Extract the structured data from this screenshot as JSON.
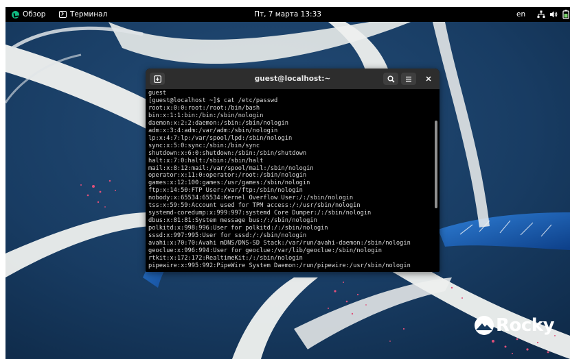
{
  "topbar": {
    "activities_label": "Обзор",
    "app_menu_label": "Терминал",
    "clock": "Пт, 7 марта 13:33",
    "language": "en"
  },
  "terminal": {
    "title": "guest@localhost:~",
    "lines": [
      "guest",
      "[guest@localhost ~]$ cat /etc/passwd",
      "root:x:0:0:root:/root:/bin/bash",
      "bin:x:1:1:bin:/bin:/sbin/nologin",
      "daemon:x:2:2:daemon:/sbin:/sbin/nologin",
      "adm:x:3:4:adm:/var/adm:/sbin/nologin",
      "lp:x:4:7:lp:/var/spool/lpd:/sbin/nologin",
      "sync:x:5:0:sync:/sbin:/bin/sync",
      "shutdown:x:6:0:shutdown:/sbin:/sbin/shutdown",
      "halt:x:7:0:halt:/sbin:/sbin/halt",
      "mail:x:8:12:mail:/var/spool/mail:/sbin/nologin",
      "operator:x:11:0:operator:/root:/sbin/nologin",
      "games:x:12:100:games:/usr/games:/sbin/nologin",
      "ftp:x:14:50:FTP User:/var/ftp:/sbin/nologin",
      "nobody:x:65534:65534:Kernel Overflow User:/:/sbin/nologin",
      "tss:x:59:59:Account used for TPM access:/:/usr/sbin/nologin",
      "systemd-coredump:x:999:997:systemd Core Dumper:/:/sbin/nologin",
      "dbus:x:81:81:System message bus:/:/sbin/nologin",
      "polkitd:x:998:996:User for polkitd:/:/sbin/nologin",
      "sssd:x:997:995:User for sssd:/:/sbin/nologin",
      "avahi:x:70:70:Avahi mDNS/DNS-SD Stack:/var/run/avahi-daemon:/sbin/nologin",
      "geoclue:x:996:994:User for geoclue:/var/lib/geoclue:/sbin/nologin",
      "rtkit:x:172:172:RealtimeKit:/:/sbin/nologin",
      "pipewire:x:995:992:PipeWire System Daemon:/run/pipewire:/usr/sbin/nologin"
    ]
  },
  "desktop": {
    "brand_logo_text": "Rocky"
  },
  "icons": {
    "activities": "rocky-leaf-icon",
    "app_menu": "terminal-icon",
    "network": "network-icon",
    "volume": "volume-icon",
    "battery": "battery-icon",
    "new_tab": "new-tab-icon",
    "search": "search-icon",
    "menu": "hamburger-menu-icon",
    "close": "close-icon"
  },
  "colors": {
    "wallpaper_base": "#173a5e",
    "ribbon": "#eef0ee",
    "accent_blue": "#1e5aa8",
    "speckle_pink": "#e0507a",
    "rocky_green": "#10b981"
  }
}
